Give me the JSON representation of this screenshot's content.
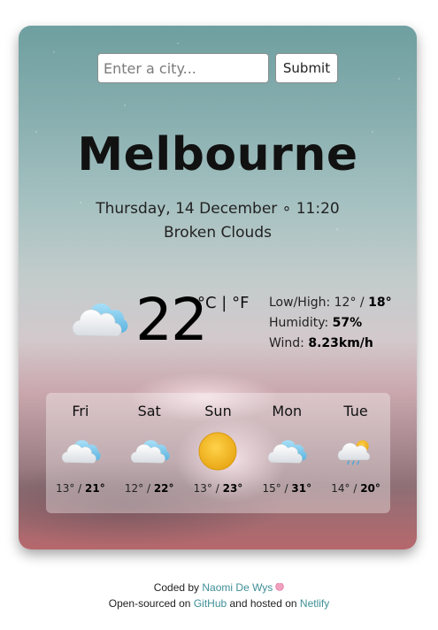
{
  "search": {
    "placeholder": "Enter a city...",
    "value": "",
    "submit_label": "Submit"
  },
  "city": "Melbourne",
  "datetime": "Thursday, 14 December ∘ 11:20",
  "description": "Broken Clouds",
  "current": {
    "icon": "cloud-icon",
    "temperature": "22",
    "unit_c": "°C",
    "unit_sep": " | ",
    "unit_f": "°F",
    "lowhigh_label": "Low/High: ",
    "low": "12°",
    "lowhigh_sep": " / ",
    "high": "18°",
    "humidity_label": "Humidity: ",
    "humidity": "57%",
    "wind_label": "Wind: ",
    "wind": "8.23km/h"
  },
  "forecast": [
    {
      "day": "Fri",
      "icon": "cloud-icon",
      "low": "13°",
      "high": "21°"
    },
    {
      "day": "Sat",
      "icon": "cloud-icon",
      "low": "12°",
      "high": "22°"
    },
    {
      "day": "Sun",
      "icon": "sun-icon",
      "low": "13°",
      "high": "23°"
    },
    {
      "day": "Mon",
      "icon": "cloud-icon",
      "low": "15°",
      "high": "31°"
    },
    {
      "day": "Tue",
      "icon": "rain-cloud-sun-icon",
      "low": "14°",
      "high": "20°"
    }
  ],
  "temp_sep": " / ",
  "footer": {
    "coded_by": "Coded by ",
    "author": "Naomi De Wys",
    "open_sourced": "Open-sourced on ",
    "github": "GitHub",
    "hosted": " and hosted on ",
    "netlify": "Netlify"
  },
  "colors": {
    "link": "#3e8f96",
    "cloud_blue": "#7ec8ea",
    "sun": "#f2b51e"
  }
}
